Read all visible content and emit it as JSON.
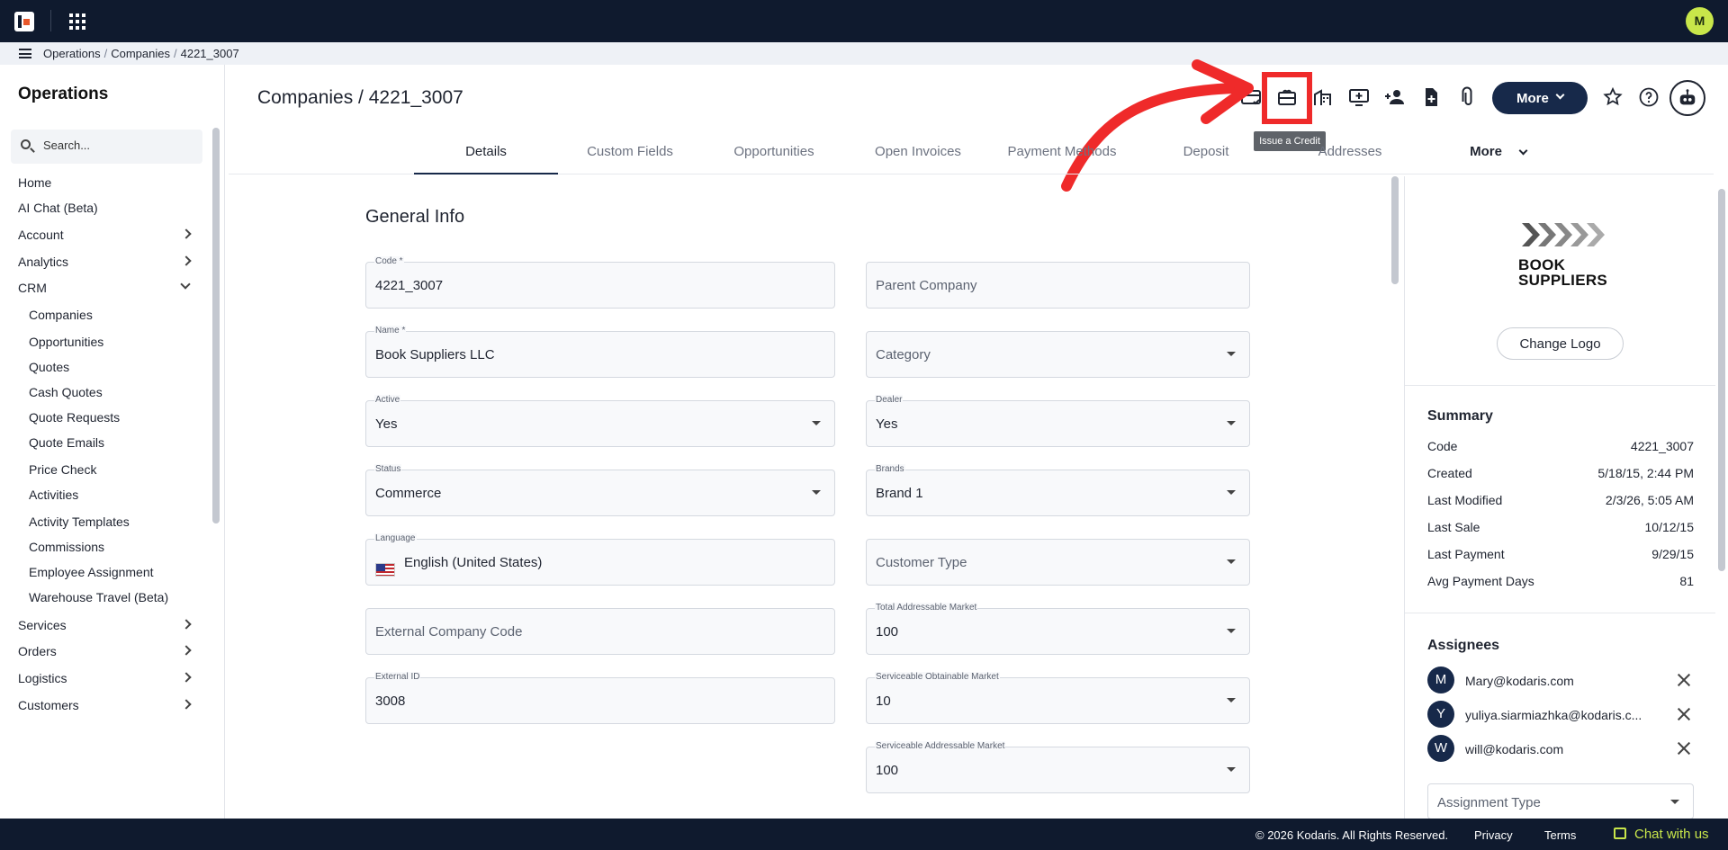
{
  "breadcrumb": [
    "Operations",
    "Companies",
    "4221_3007"
  ],
  "sidebar": {
    "title": "Operations",
    "search_placeholder": "Search...",
    "items": [
      {
        "label": "Home",
        "type": "top"
      },
      {
        "label": "AI Chat (Beta)",
        "type": "top"
      },
      {
        "label": "Account",
        "type": "expandable"
      },
      {
        "label": "Analytics",
        "type": "expandable"
      },
      {
        "label": "CRM",
        "type": "expanded"
      },
      {
        "label": "Companies",
        "type": "sub"
      },
      {
        "label": "Opportunities",
        "type": "sub"
      },
      {
        "label": "Quotes",
        "type": "sub"
      },
      {
        "label": "Cash Quotes",
        "type": "sub"
      },
      {
        "label": "Quote Requests",
        "type": "sub"
      },
      {
        "label": "Quote Emails",
        "type": "sub"
      },
      {
        "label": "Price Check",
        "type": "sub"
      },
      {
        "label": "Activities",
        "type": "sub"
      },
      {
        "label": "Activity Templates",
        "type": "sub"
      },
      {
        "label": "Commissions",
        "type": "sub"
      },
      {
        "label": "Employee Assignment",
        "type": "sub"
      },
      {
        "label": "Warehouse Travel (Beta)",
        "type": "sub"
      },
      {
        "label": "Services",
        "type": "expandable"
      },
      {
        "label": "Orders",
        "type": "expandable"
      },
      {
        "label": "Logistics",
        "type": "expandable"
      },
      {
        "label": "Customers",
        "type": "expandable"
      }
    ]
  },
  "header": {
    "title": "Companies / 4221_3007",
    "more_label": "More",
    "tooltip": "Issue a Credit",
    "icons": [
      "payment-card-icon",
      "gift-card-icon",
      "warehouse-icon",
      "add-screen-icon",
      "add-person-icon",
      "add-file-icon",
      "attachment-icon",
      "star-icon",
      "help-icon",
      "bot-icon"
    ]
  },
  "tabs": [
    "Details",
    "Custom Fields",
    "Opportunities",
    "Open Invoices",
    "Payment Methods",
    "Deposit",
    "Addresses",
    "More"
  ],
  "active_tab": "Details",
  "form": {
    "section_title": "General Info",
    "left": [
      {
        "label": "Code *",
        "value": "4221_3007",
        "dropdown": false
      },
      {
        "label": "Name *",
        "value": "Book Suppliers LLC",
        "dropdown": false
      },
      {
        "label": "Active",
        "value": "Yes",
        "dropdown": true
      },
      {
        "label": "Status",
        "value": "Commerce",
        "dropdown": true
      },
      {
        "label": "Language",
        "value": "English (United States)",
        "dropdown": false,
        "flag": true
      },
      {
        "label": "",
        "placeholder": "External Company Code",
        "value": "",
        "dropdown": false
      },
      {
        "label": "External ID",
        "value": "3008",
        "dropdown": false
      }
    ],
    "right": [
      {
        "label": "",
        "placeholder": "Parent Company",
        "value": "",
        "dropdown": false
      },
      {
        "label": "",
        "placeholder": "Category",
        "value": "",
        "dropdown": true
      },
      {
        "label": "Dealer",
        "value": "Yes",
        "dropdown": true
      },
      {
        "label": "Brands",
        "value": "Brand 1",
        "dropdown": true
      },
      {
        "label": "",
        "placeholder": "Customer Type",
        "value": "",
        "dropdown": true
      },
      {
        "label": "Total Addressable Market",
        "value": "100",
        "dropdown": true
      },
      {
        "label": "Serviceable Obtainable Market",
        "value": "10",
        "dropdown": true
      },
      {
        "label": "Serviceable Addressable Market",
        "value": "100",
        "dropdown": true
      }
    ]
  },
  "panel": {
    "logo_line1": "BOOK",
    "logo_line2": "SUPPLIERS",
    "change_logo": "Change Logo",
    "summary_title": "Summary",
    "summary": [
      {
        "k": "Code",
        "v": "4221_3007"
      },
      {
        "k": "Created",
        "v": "5/18/15, 2:44 PM"
      },
      {
        "k": "Last Modified",
        "v": "2/3/26, 5:05 AM"
      },
      {
        "k": "Last Sale",
        "v": "10/12/15"
      },
      {
        "k": "Last Payment",
        "v": "9/29/15"
      },
      {
        "k": "Avg Payment Days",
        "v": "81"
      }
    ],
    "assignees_title": "Assignees",
    "assignees": [
      {
        "initial": "M",
        "email": "Mary@kodaris.com"
      },
      {
        "initial": "Y",
        "email": "yuliya.siarmiazhka@kodaris.c..."
      },
      {
        "initial": "W",
        "email": "will@kodaris.com"
      }
    ],
    "assignment_type_placeholder": "Assignment Type"
  },
  "footer": {
    "copyright": "© 2026 Kodaris. All Rights Reserved.",
    "privacy": "Privacy",
    "terms": "Terms",
    "chat": "Chat with us"
  },
  "user_initial": "M",
  "colors": {
    "nav": "#0f1a2e",
    "accent": "#17294a",
    "avatar": "#c8e64a",
    "highlight": "#ef2a2a"
  }
}
